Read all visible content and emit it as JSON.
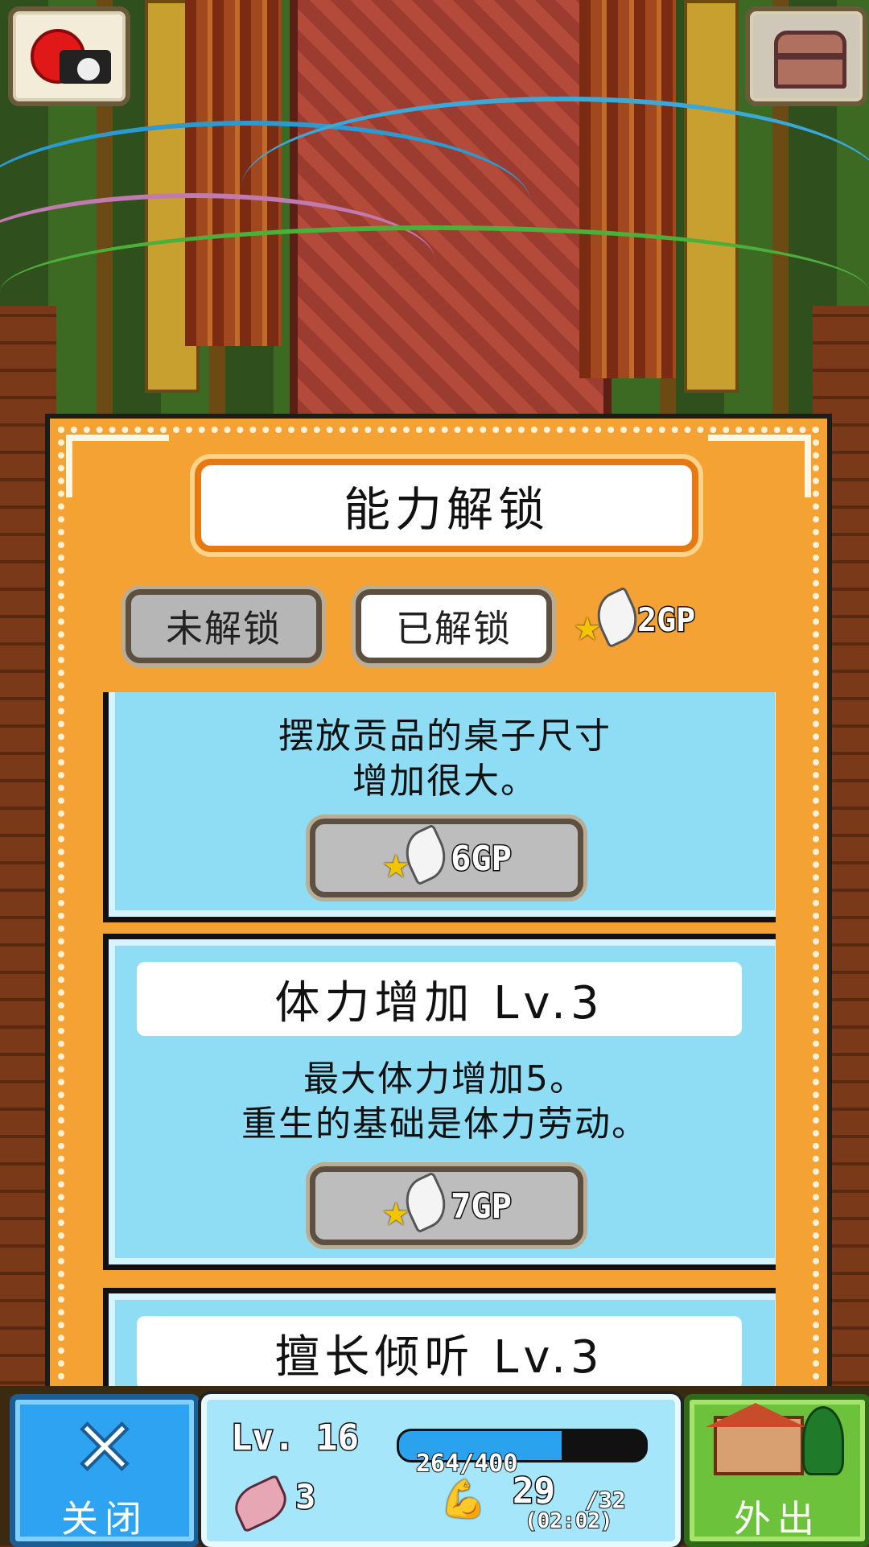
{
  "top_buttons": {
    "camera_icon": "camera-icon",
    "chest_icon": "treasure-chest-icon"
  },
  "panel": {
    "title": "能力解锁",
    "tabs": [
      {
        "label": "未解锁",
        "selected": false
      },
      {
        "label": "已解锁",
        "selected": true
      }
    ],
    "gp_total": "2GP",
    "currency_icon": "winged-star-icon"
  },
  "abilities": [
    {
      "title": "",
      "description": [
        "摆放贡品的桌子尺寸",
        "增加很大。"
      ],
      "cost": "6GP"
    },
    {
      "title": "体力增加 Lv.3",
      "description": [
        "最大体力增加5。",
        "重生的基础是体力劳动。"
      ],
      "cost": "7GP"
    },
    {
      "title": "擅长倾听 Lv.3",
      "description": [],
      "cost": ""
    }
  ],
  "hud": {
    "close_label": "关闭",
    "level": "Lv. 16",
    "exp_text": "264/400",
    "exp_fraction": 0.66,
    "feathers": "3",
    "stamina": "29",
    "stamina_max": "/32",
    "timer": "(02:02)",
    "out_label": "外出"
  },
  "colors": {
    "panel_orange": "#f5a234",
    "card_blue": "#8fdcf5",
    "close_blue": "#2ea3f2",
    "out_green": "#6cc23a"
  }
}
